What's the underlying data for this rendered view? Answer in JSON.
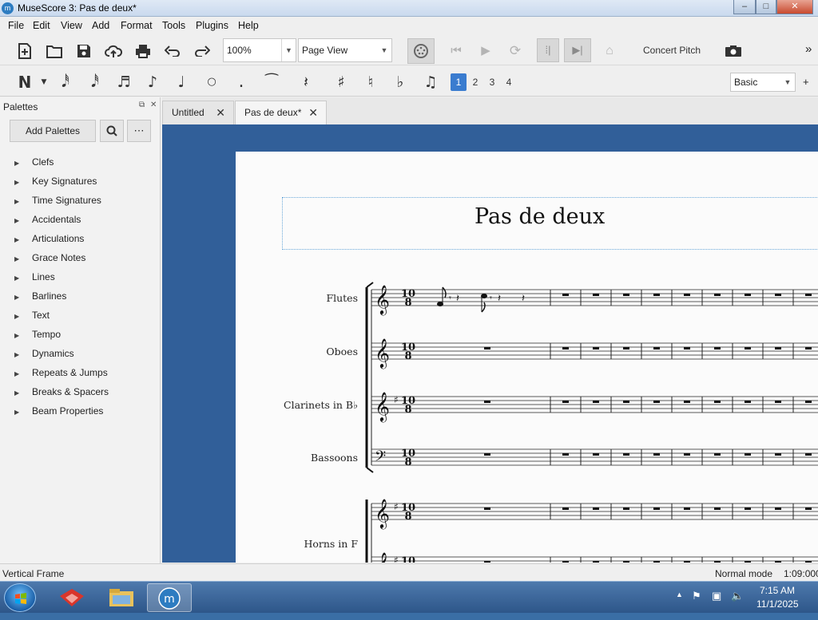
{
  "window": {
    "title": "MuseScore 3: Pas de deux*",
    "icon": "musescore-icon",
    "controls": {
      "minimize": "–",
      "maximize": "□",
      "close": "✕"
    }
  },
  "menu": [
    "File",
    "Edit",
    "View",
    "Add",
    "Format",
    "Tools",
    "Plugins",
    "Help"
  ],
  "toolbar": {
    "zoom_value": "100%",
    "view_mode": "Page View",
    "concert_pitch_label": "Concert Pitch",
    "overflow": "»"
  },
  "note_input": {
    "workspace": "Basic",
    "add_workspace": "+",
    "voices": [
      "1",
      "2",
      "3",
      "4"
    ],
    "active_voice": "1"
  },
  "palettes_panel": {
    "title": "Palettes",
    "add_button": "Add Palettes",
    "items": [
      "Clefs",
      "Key Signatures",
      "Time Signatures",
      "Accidentals",
      "Articulations",
      "Grace Notes",
      "Lines",
      "Barlines",
      "Text",
      "Tempo",
      "Dynamics",
      "Repeats & Jumps",
      "Breaks & Spacers",
      "Beam Properties"
    ]
  },
  "tabs": [
    {
      "label": "Untitled",
      "active": false
    },
    {
      "label": "Pas de deux*",
      "active": true
    }
  ],
  "score": {
    "title": "Pas de deux",
    "time_signature": {
      "numerator": "10",
      "denominator": "8"
    },
    "instruments": [
      "Flutes",
      "Oboes",
      "Clarinets in B♭",
      "Bassoons",
      "Horns in F"
    ]
  },
  "status": {
    "left": "Vertical Frame",
    "mode": "Normal mode",
    "time": "1:09:000"
  },
  "taskbar": {
    "clock_time": "7:15 AM",
    "clock_date": "11/1/2025"
  },
  "colors": {
    "canvas_bg": "#315f99",
    "accent": "#3a7ccf",
    "taskbar": "#2d5689"
  }
}
